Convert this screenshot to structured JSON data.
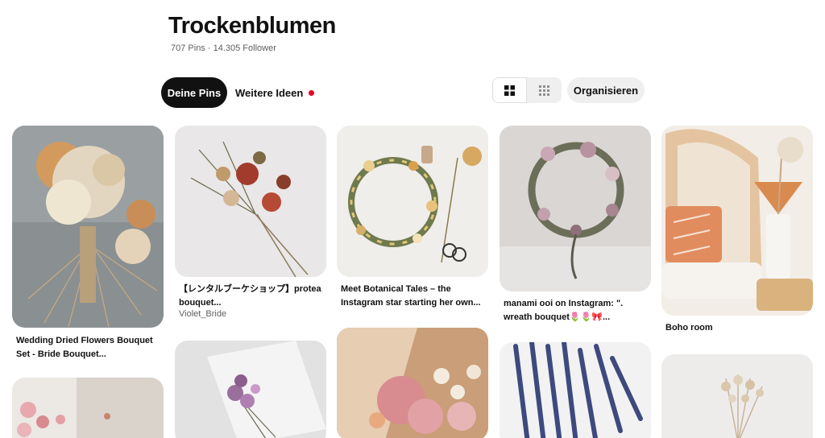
{
  "board": {
    "title": "Trockenblumen",
    "meta": "707 Pins · 14.305 Follower"
  },
  "tabs": [
    {
      "label": "Deine Pins",
      "active": true
    },
    {
      "label": "Weitere Ideen",
      "active": false,
      "has_notification": true
    }
  ],
  "view_toggle": {
    "options": [
      "grid-large-icon",
      "grid-compact-icon"
    ],
    "selected": "grid-large-icon"
  },
  "organize_label": "Organisieren",
  "pins": [
    {
      "title_line1": "Wedding Dried Flowers Bouquet",
      "title_line2": "Set - Bride Bouquet...",
      "subtitle": ""
    },
    {
      "title_line1": "【レンタルブーケショップ】protea",
      "title_line2": "bouquet...",
      "subtitle": "Violet_Bride"
    },
    {
      "title_line1": "Meet Botanical Tales – the",
      "title_line2": "Instagram star starting her own...",
      "subtitle": ""
    },
    {
      "title_line1": "manami ooi on Instagram: \".",
      "title_line2": "wreath bouquet🌷🌷🎀...",
      "subtitle": ""
    },
    {
      "title_line1": "Boho room",
      "title_line2": "",
      "subtitle": ""
    }
  ],
  "colors": {
    "accent_red": "#e60023",
    "tab_active_bg": "#111111",
    "button_bg": "#efefef"
  }
}
